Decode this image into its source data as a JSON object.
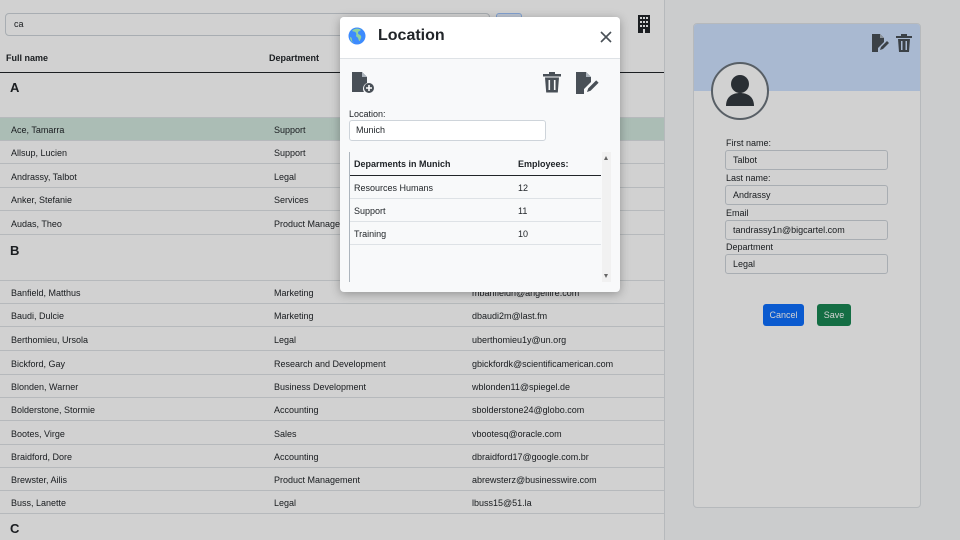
{
  "search": {
    "value": "ca"
  },
  "list": {
    "headers": {
      "name": "Full name",
      "department": "Department"
    },
    "groups": [
      {
        "letter": "A",
        "rows": [
          {
            "name": "Ace, Tamarra",
            "department": "Support",
            "email": ""
          },
          {
            "name": "Allsup, Lucien",
            "department": "Support",
            "email": ""
          },
          {
            "name": "Andrassy, Talbot",
            "department": "Legal",
            "email": ""
          },
          {
            "name": "Anker, Stefanie",
            "department": "Services",
            "email": ""
          },
          {
            "name": "Audas, Theo",
            "department": "Product Manage",
            "email": ""
          }
        ]
      },
      {
        "letter": "B",
        "rows": [
          {
            "name": "Banfield, Matthus",
            "department": "Marketing",
            "email": "mbanfieldn@angelfire.com"
          },
          {
            "name": "Baudi, Dulcie",
            "department": "Marketing",
            "email": "dbaudi2m@last.fm"
          },
          {
            "name": "Berthomieu, Ursola",
            "department": "Legal",
            "email": "uberthomieu1y@un.org"
          },
          {
            "name": "Bickford, Gay",
            "department": "Research and Development",
            "email": "gbickfordk@scientificamerican.com"
          },
          {
            "name": "Blonden, Warner",
            "department": "Business Development",
            "email": "wblonden11@spiegel.de"
          },
          {
            "name": "Bolderstone, Stormie",
            "department": "Accounting",
            "email": "sbolderstone24@globo.com"
          },
          {
            "name": "Bootes, Virge",
            "department": "Sales",
            "email": "vbootesq@oracle.com"
          },
          {
            "name": "Braidford, Dore",
            "department": "Accounting",
            "email": "dbraidford17@google.com.br"
          },
          {
            "name": "Brewster, Ailis",
            "department": "Product Management",
            "email": "abrewsterz@businesswire.com"
          },
          {
            "name": "Buss, Lanette",
            "department": "Legal",
            "email": "lbuss15@51.la"
          }
        ]
      },
      {
        "letter": "C",
        "rows": []
      }
    ]
  },
  "detail": {
    "first_name_label": "First name:",
    "first_name": "Talbot",
    "last_name_label": "Last name:",
    "last_name": "Andrassy",
    "email_label": "Email",
    "email": "tandrassy1n@bigcartel.com",
    "department_label": "Department",
    "department": "Legal",
    "cancel": "Cancel",
    "save": "Save"
  },
  "modal": {
    "title": "Location",
    "location_label": "Location:",
    "location_value": "Munich",
    "table": {
      "col1": "Deparments in Munich",
      "col2": "Employees:",
      "rows": [
        {
          "department": "Resources Humans",
          "employees": "12"
        },
        {
          "department": "Support",
          "employees": "11"
        },
        {
          "department": "Training",
          "employees": "10"
        }
      ]
    }
  },
  "colors": {
    "primary": "#0d6efd",
    "success": "#198754",
    "selected_row": "#d1e7dd",
    "card_header": "#cfe2ff"
  },
  "icons": [
    "search-icon",
    "building-icon",
    "globe-icon",
    "close-icon",
    "file-add-icon",
    "trash-icon",
    "file-edit-icon",
    "user-avatar-icon"
  ]
}
